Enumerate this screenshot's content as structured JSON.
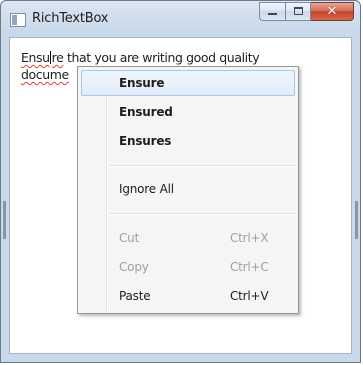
{
  "window": {
    "title": "RichTextBox",
    "icon": "app-window-icon",
    "controls": {
      "minimize_icon": "minimize-icon",
      "maximize_icon": "maximize-icon",
      "close_glyph": "✕"
    }
  },
  "editor": {
    "misspelled_start": "Ensu",
    "misspelled_end": "re",
    "text_rest": " that you are writing good quality",
    "text_line2_visible": "docume",
    "underline_color": "#e0412b"
  },
  "context_menu": {
    "suggestions": [
      {
        "label": "Ensure",
        "highlighted": true
      },
      {
        "label": "Ensured",
        "highlighted": false
      },
      {
        "label": "Ensures",
        "highlighted": false
      }
    ],
    "ignore_all": "Ignore All",
    "edit_items": [
      {
        "label": "Cut",
        "shortcut": "Ctrl+X",
        "enabled": false
      },
      {
        "label": "Copy",
        "shortcut": "Ctrl+C",
        "enabled": false
      },
      {
        "label": "Paste",
        "shortcut": "Ctrl+V",
        "enabled": true
      }
    ],
    "highlight_border_color": "#a8c7ea",
    "disabled_color": "#a0a0a0"
  },
  "colors": {
    "close_button": "#c3432a",
    "frame": "#c9d8ea"
  }
}
